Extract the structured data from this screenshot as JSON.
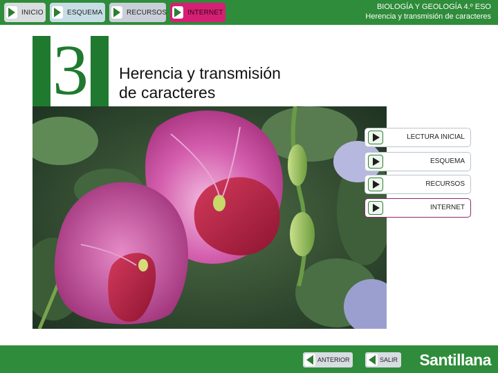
{
  "nav": {
    "inicio": "INICIO",
    "esquema": "ESQUEMA",
    "recursos": "RECURSOS",
    "internet": "INTERNET"
  },
  "header": {
    "course": "BIOLOGÍA Y GEOLOGÍA 4.º ESO",
    "unit": "Herencia y transmisión de caracteres"
  },
  "chapter": {
    "number": "3",
    "title_line1": "Herencia y transmisión",
    "title_line2": "de caracteres"
  },
  "menu": {
    "items": [
      {
        "label": "LECTURA INICIAL"
      },
      {
        "label": "ESQUEMA"
      },
      {
        "label": "RECURSOS"
      },
      {
        "label": "INTERNET"
      }
    ]
  },
  "footer": {
    "anterior": "ANTERIOR",
    "salir": "SALIR",
    "brand": "Santillana"
  },
  "colors": {
    "bar_green": "#2e8c3a",
    "chapter_green": "#1f7a30",
    "internet_pink": "#d51f74"
  },
  "icons": [
    "play-icon",
    "back-arrow-icon"
  ]
}
